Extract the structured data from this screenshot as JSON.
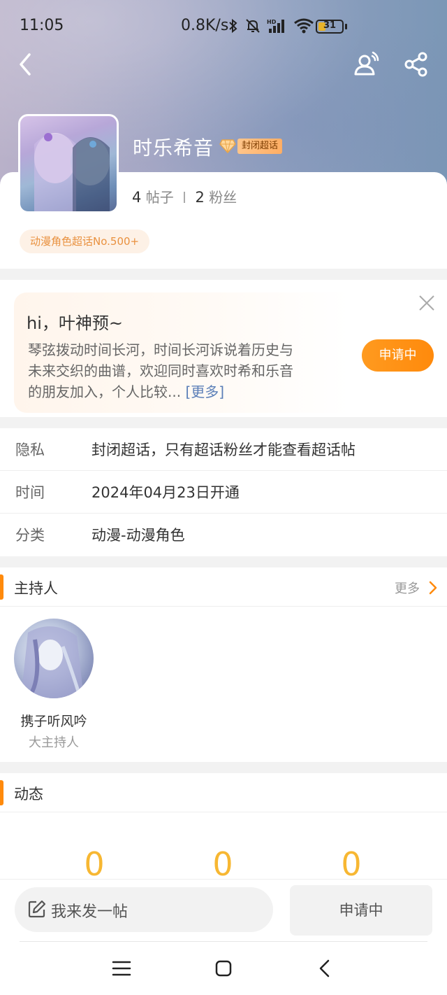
{
  "status_bar": {
    "time": "11:05",
    "net_speed": "0.8K/s",
    "battery": "31",
    "battery_level": 0.31,
    "icons": [
      "bluetooth-icon",
      "mute-bell-icon",
      "hd-signal-icon",
      "wifi-icon",
      "battery-icon"
    ]
  },
  "header": {
    "back_icon": "chevron-left-icon",
    "user_icon": "user-signal-icon",
    "share_icon": "share-icon"
  },
  "topic": {
    "title": "时乐希音",
    "badge": "封闭超话",
    "posts_count": "4",
    "posts_label": "帖子",
    "fans_count": "2",
    "fans_label": "粉丝",
    "rank_tag": "动漫角色超话No.500+"
  },
  "welcome": {
    "greeting": "hi，叶神预~",
    "description": "琴弦拨动时间长河，时间长河诉说着历史与未来交织的曲谱，欢迎同时喜欢时希和乐音的朋友加入，个人比较...",
    "more_link": "[更多]",
    "apply_button": "申请中"
  },
  "info": [
    {
      "label": "隐私",
      "value": "封闭超话，只有超话粉丝才能查看超话帖"
    },
    {
      "label": "时间",
      "value": "2024年04月23日开通"
    },
    {
      "label": "分类",
      "value": "动漫-动漫角色"
    }
  ],
  "host_section": {
    "title": "主持人",
    "more": "更多",
    "host_name": "携子听风吟",
    "host_role": "大主持人"
  },
  "activity_section": {
    "title": "动态",
    "counts": [
      "0",
      "0",
      "0"
    ]
  },
  "bottom": {
    "post_button": "我来发一帖",
    "applying_button": "申请中"
  },
  "colors": {
    "accent": "#ff8a0c",
    "count_color": "#f7b732",
    "rank_text": "#e9913f"
  }
}
